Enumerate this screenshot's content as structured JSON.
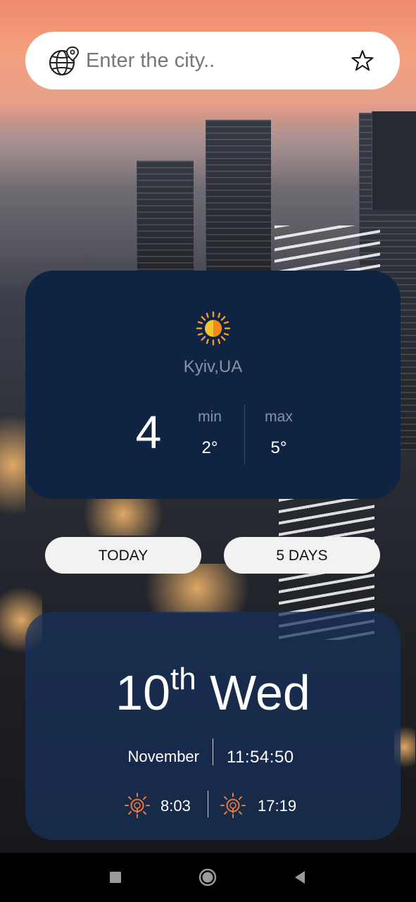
{
  "search": {
    "placeholder": "Enter the city..",
    "value": ""
  },
  "weather": {
    "city": "Kyiv,UA",
    "temperature": "4",
    "min_label": "min",
    "min_value": "2°",
    "max_label": "max",
    "max_value": "5°",
    "icon": "sun-icon"
  },
  "tabs": {
    "today_label": "TODAY",
    "five_days_label": "5 DAYS"
  },
  "date": {
    "day_number": "10",
    "day_suffix": "th",
    "weekday": "Wed",
    "month": "November",
    "time": "11:54:50",
    "sunrise": "8:03",
    "sunset": "17:19"
  },
  "colors": {
    "card_bg": "#0f2442",
    "sun_accent": "#f29a2e",
    "sunrise_icon": "#e8773a"
  },
  "navbar": {
    "icons": [
      "recent-apps-icon",
      "home-icon",
      "back-icon"
    ]
  }
}
